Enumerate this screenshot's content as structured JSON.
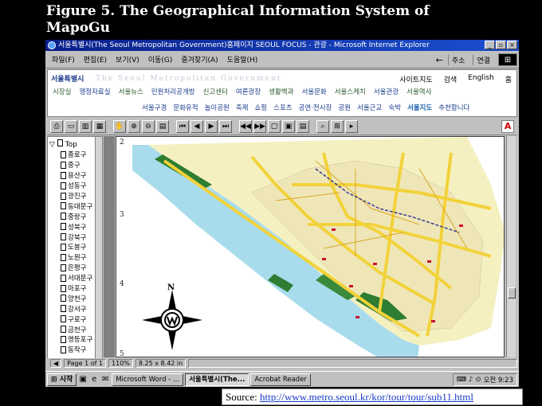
{
  "figure_title": "Figure 5. The Geographical Information System of MapoGu",
  "window": {
    "title": "서울특별시(The Seoul Metropolitan Government)홈페이지 SEOUL FOCUS - 관광 - Microsoft Internet Explorer",
    "buttons": [
      "_",
      "▫",
      "×"
    ]
  },
  "menubar": {
    "items": [
      "파일(F)",
      "편집(E)",
      "보기(V)",
      "이동(G)",
      "즐겨찾기(A)",
      "도움말(H)"
    ],
    "back": "←",
    "address_label": "주소",
    "links_label": "연결"
  },
  "site": {
    "logo": "서울특별시",
    "logo_en": "The Seoul Metropolitan Government",
    "util_links": [
      "사이트지도",
      "검색",
      "English",
      "홈"
    ],
    "nav_row1": [
      "시장실",
      "행정자료실",
      "서울뉴스",
      "민원처리공개방",
      "신고센터",
      "여론광장",
      "생활백과",
      "서울문화",
      "서울스케치",
      "서울관광",
      "서울역사"
    ],
    "nav_row2": [
      "서울구경",
      "문화유적",
      "놀이공원",
      "축제",
      "쇼핑",
      "스포츠",
      "공연·전시장",
      "공원",
      "서울근교",
      "숙박",
      "서울지도",
      "추천합니다"
    ],
    "nav_row2_highlight": "서울지도"
  },
  "viewer": {
    "acrobat_badge": "A"
  },
  "bookmarks": {
    "root": "Top",
    "items": [
      "종로구",
      "중구",
      "용산구",
      "성동구",
      "광진구",
      "동대문구",
      "중랑구",
      "성북구",
      "강북구",
      "도봉구",
      "노원구",
      "은평구",
      "서대문구",
      "마포구",
      "양천구",
      "강서구",
      "구로구",
      "금천구",
      "영등포구",
      "동작구"
    ]
  },
  "map": {
    "grid_labels": [
      "2",
      "3",
      "4",
      "5"
    ],
    "compass_n": "N"
  },
  "statusbar": {
    "page": "Page 1 of 1",
    "zoom": "110%",
    "size": "8.25 x 8.42 in"
  },
  "taskbar": {
    "start": "시작",
    "tasks": [
      "Microsoft Word - ...",
      "서울특별시(The...",
      "Acrobat Reader"
    ],
    "active_task_index": 1,
    "clock": "오전 9:23"
  },
  "source": {
    "label": "Source:",
    "url": "http://www.metro.seoul.kr/kor/tour/tour/sub11.html"
  },
  "colors": {
    "titlebar": "#0a1f8a",
    "river": "#a8dcec",
    "land": "#f5f0c0",
    "roads": "#f2d23a",
    "park": "#2e7d32"
  }
}
